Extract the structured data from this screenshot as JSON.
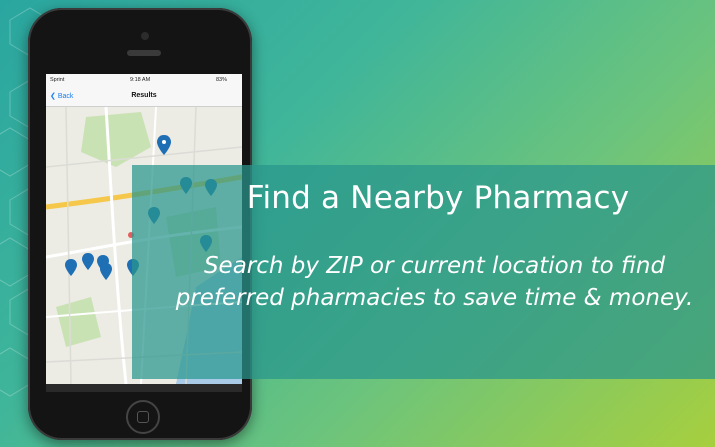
{
  "slide": {
    "headline": "Find a Nearby Pharmacy",
    "subtext": "Search by ZIP or current location to find preferred pharmacies to save time & money.",
    "colors": {
      "gradient_start": "#2aa6a0",
      "gradient_end": "#a7cf3e",
      "banner": "#2a968c",
      "text": "#ffffff"
    }
  },
  "phone": {
    "status": {
      "carrier": "Sprint",
      "time": "9:18 AM",
      "battery": "83%"
    },
    "nav": {
      "back_label": "Back",
      "title": "Results"
    },
    "icons": {
      "back": "chevron-left-icon",
      "pin": "map-pin-icon"
    }
  }
}
